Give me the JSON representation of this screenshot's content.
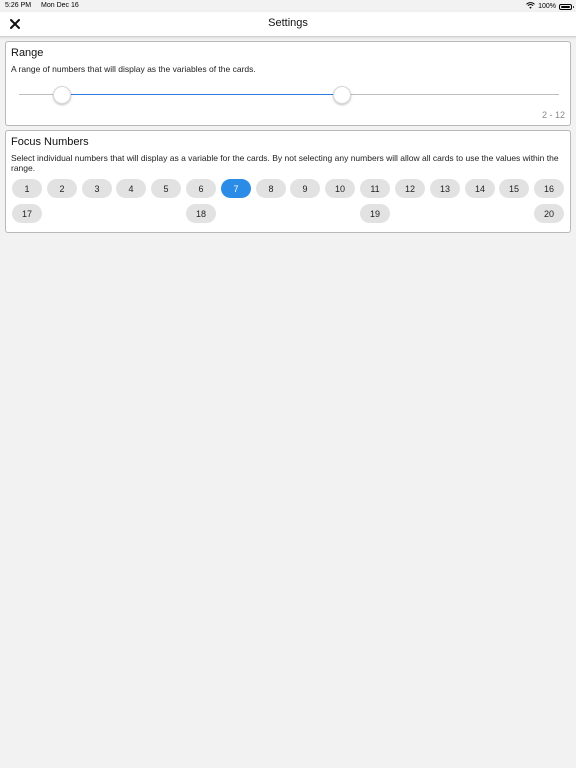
{
  "status_bar": {
    "time": "5:26 PM",
    "date": "Mon Dec 16",
    "battery": "100%"
  },
  "nav": {
    "title": "Settings",
    "close_icon": "close-icon"
  },
  "range": {
    "title": "Range",
    "description": "A range of numbers that will display as the variables of the cards.",
    "min": 2,
    "max": 12,
    "value_label": "2 - 12",
    "accent_color": "#2c7be5"
  },
  "focus": {
    "title": "Focus Numbers",
    "description": "Select individual numbers that will display as a variable for the cards. By not selecting any numbers will allow all cards to use the values within the range.",
    "numbers": [
      "1",
      "2",
      "3",
      "4",
      "5",
      "6",
      "7",
      "8",
      "9",
      "10",
      "11",
      "12",
      "13",
      "14",
      "15",
      "16",
      "17",
      "18",
      "19",
      "20"
    ],
    "selected": [
      "7"
    ],
    "selected_color": "#2a8ce6",
    "chip_color": "#e2e2e2"
  }
}
